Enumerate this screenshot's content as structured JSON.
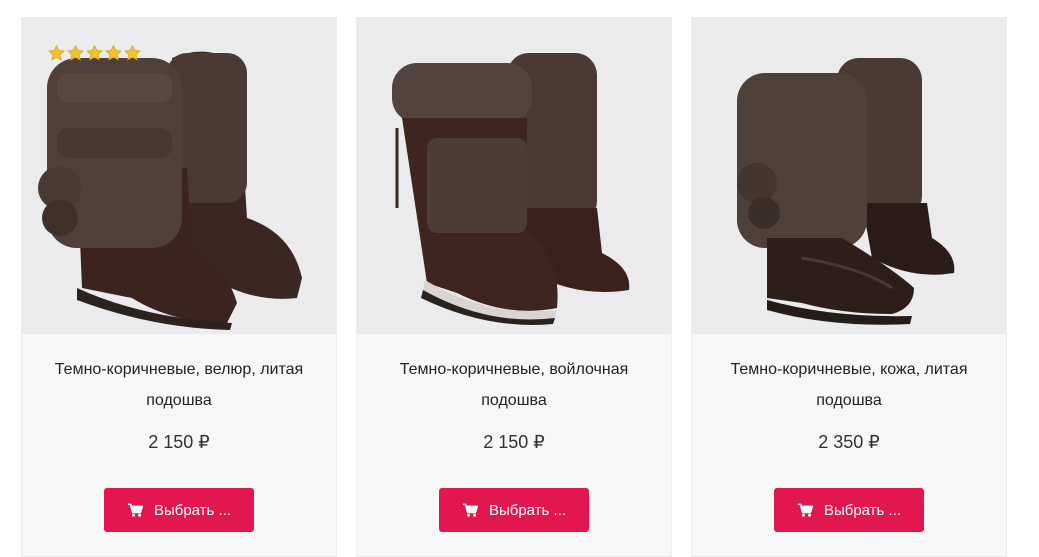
{
  "colors": {
    "accent": "#e3174f",
    "card_bg": "#f7f7f8",
    "star": "#f2c12e"
  },
  "products": [
    {
      "title": "Темно-коричневые, велюр, литая подошва",
      "price": "2 150 ₽",
      "button_label": "Выбрать ...",
      "button_icon": "cart-icon",
      "rating": 5,
      "material": "velour"
    },
    {
      "title": "Темно-коричневые, войлочная подошва",
      "price": "2 150 ₽",
      "button_label": "Выбрать ...",
      "button_icon": "cart-icon",
      "material": "felt"
    },
    {
      "title": "Темно-коричневые, кожа, литая подошва",
      "price": "2 350 ₽",
      "button_label": "Выбрать ...",
      "button_icon": "cart-icon",
      "material": "leather"
    }
  ]
}
